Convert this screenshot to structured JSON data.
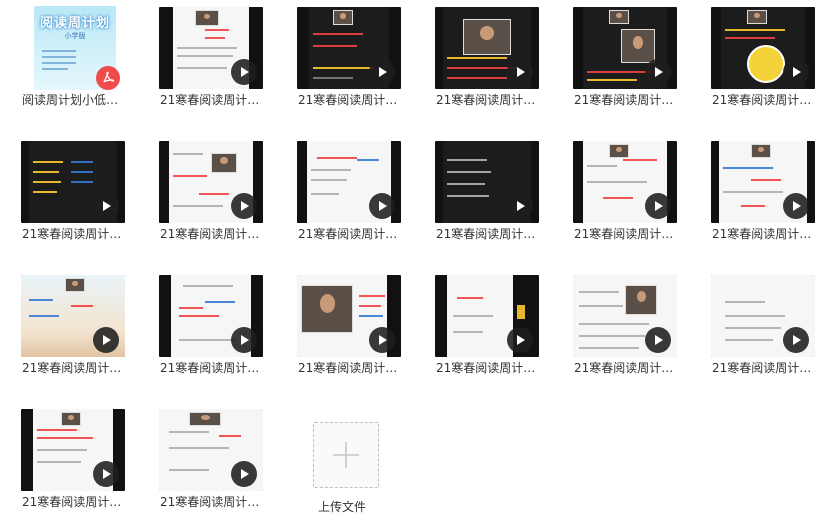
{
  "files": [
    {
      "name": "阅读周计划小低…",
      "kind": "pdf"
    },
    {
      "name": "21寒春阅读周计…",
      "kind": "video"
    },
    {
      "name": "21寒春阅读周计…",
      "kind": "video"
    },
    {
      "name": "21寒春阅读周计…",
      "kind": "video"
    },
    {
      "name": "21寒春阅读周计…",
      "kind": "video"
    },
    {
      "name": "21寒春阅读周计…",
      "kind": "video"
    },
    {
      "name": "21寒春阅读周计…",
      "kind": "video"
    },
    {
      "name": "21寒春阅读周计…",
      "kind": "video"
    },
    {
      "name": "21寒春阅读周计…",
      "kind": "video"
    },
    {
      "name": "21寒春阅读周计…",
      "kind": "video"
    },
    {
      "name": "21寒春阅读周计…",
      "kind": "video"
    },
    {
      "name": "21寒春阅读周计…",
      "kind": "video"
    },
    {
      "name": "21寒春阅读周计…",
      "kind": "video"
    },
    {
      "name": "21寒春阅读周计…",
      "kind": "video"
    },
    {
      "name": "21寒春阅读周计…",
      "kind": "video"
    },
    {
      "name": "21寒春阅读周计…",
      "kind": "video"
    },
    {
      "name": "21寒春阅读周计…",
      "kind": "video"
    },
    {
      "name": "21寒春阅读周计…",
      "kind": "video"
    },
    {
      "name": "21寒春阅读周计…",
      "kind": "video"
    },
    {
      "name": "21寒春阅读周计…",
      "kind": "video"
    }
  ],
  "cover": {
    "title": "阅读周计划",
    "subtitle": "小学版"
  },
  "upload": {
    "label": "上传文件",
    "icon": "plus-icon"
  },
  "colors": {
    "play_bg": "#1e1e1e",
    "pdf_badge": "#ee4b4b",
    "cover_bg": "#b9e7f6"
  }
}
